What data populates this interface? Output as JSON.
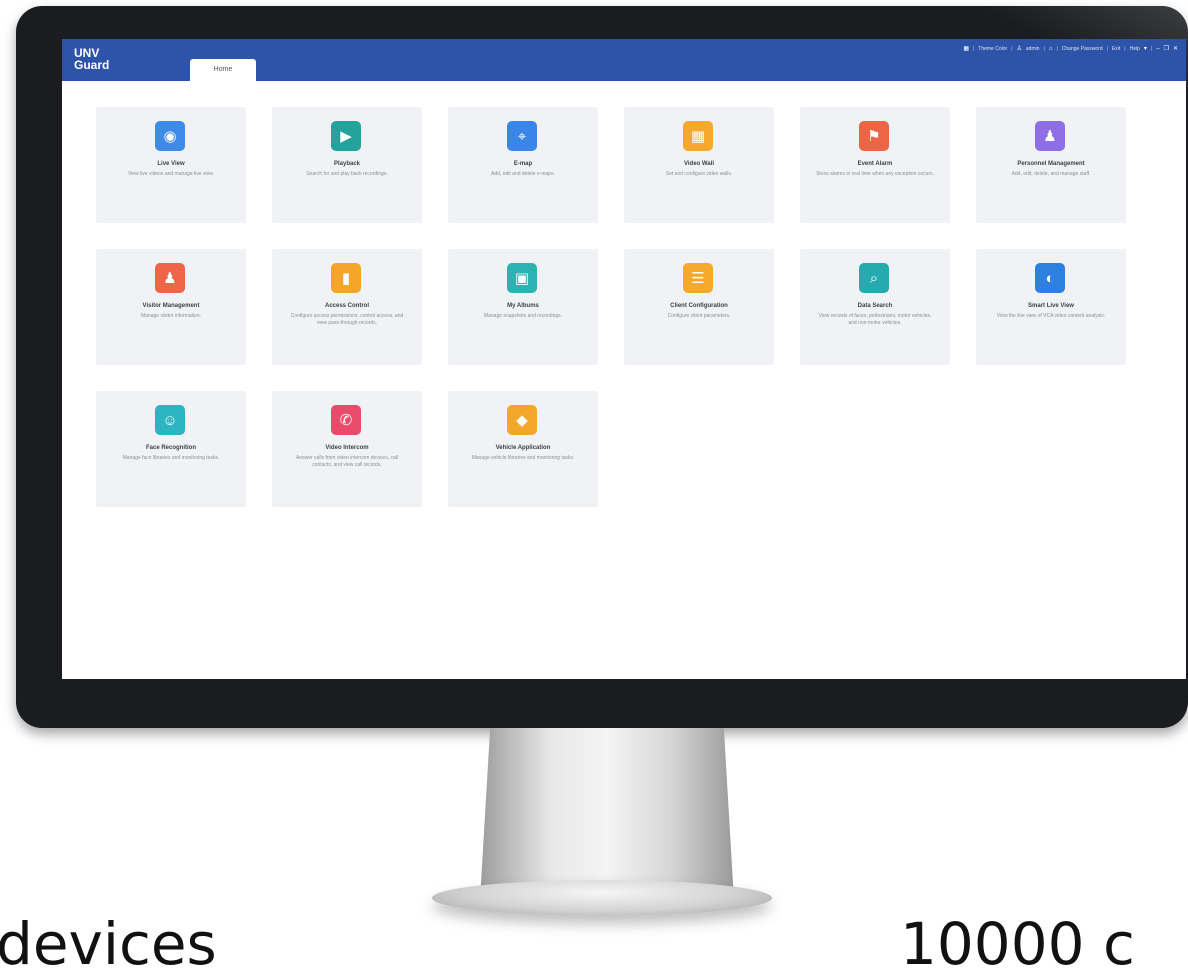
{
  "app": {
    "brand_line1": "UNV",
    "brand_line2": "Guard",
    "tab_home": "Home"
  },
  "toplinks": {
    "menu_icon": "grid-icon",
    "theme_color": "Theme Color",
    "user": "admin",
    "lock_icon": "lock-icon",
    "change_password": "Change Password",
    "exit": "Exit",
    "help": "Help"
  },
  "modules": [
    {
      "title": "Live View",
      "desc": "View live videos and manage live view.",
      "icon": "camera-icon",
      "color": "#3d8ae9",
      "glyph": "◉"
    },
    {
      "title": "Playback",
      "desc": "Search for and play back recordings.",
      "icon": "playback-icon",
      "color": "#23a39b",
      "glyph": "▶"
    },
    {
      "title": "E-map",
      "desc": "Add, edit and delete e-maps.",
      "icon": "map-icon",
      "color": "#3a86e8",
      "glyph": "⌖"
    },
    {
      "title": "Video Wall",
      "desc": "Set and configure video walls.",
      "icon": "grid-wall-icon",
      "color": "#f4a92e",
      "glyph": "▦"
    },
    {
      "title": "Event Alarm",
      "desc": "Show alarms in real time when any exception occurs.",
      "icon": "alarm-icon",
      "color": "#ec6545",
      "glyph": "⚑"
    },
    {
      "title": "Personnel Management",
      "desc": "Add, edit, delete, and manage staff.",
      "icon": "personnel-icon",
      "color": "#8e6fe5",
      "glyph": "♟"
    },
    {
      "title": "Visitor Management",
      "desc": "Manage visitor information.",
      "icon": "visitor-icon",
      "color": "#ee6547",
      "glyph": "♟"
    },
    {
      "title": "Access Control",
      "desc": "Configure access permissions, control access, and view pass-through records.",
      "icon": "door-icon",
      "color": "#f5a52a",
      "glyph": "▮"
    },
    {
      "title": "My Albums",
      "desc": "Manage snapshots and recordings.",
      "icon": "album-icon",
      "color": "#2ab3b0",
      "glyph": "▣"
    },
    {
      "title": "Client Configuration",
      "desc": "Configure client parameters.",
      "icon": "config-icon",
      "color": "#f6aa2c",
      "glyph": "☰"
    },
    {
      "title": "Data Search",
      "desc": "View records of faces, pedestrians, motor vehicles, and non-motor vehicles.",
      "icon": "search-icon",
      "color": "#25aab0",
      "glyph": "⌕"
    },
    {
      "title": "Smart Live View",
      "desc": "View the live view of VCA video content analysis.",
      "icon": "smart-view-icon",
      "color": "#2d7fe0",
      "glyph": "◐"
    },
    {
      "title": "Face Recognition",
      "desc": "Manage face libraries and monitoring tasks.",
      "icon": "face-icon",
      "color": "#2bb5c0",
      "glyph": "☺"
    },
    {
      "title": "Video Intercom",
      "desc": "Answer calls from video intercom devices, call contacts, and view call records.",
      "icon": "phone-icon",
      "color": "#ea4b6a",
      "glyph": "✆"
    },
    {
      "title": "Vehicle Application",
      "desc": "Manage vehicle libraries and monitoring tasks.",
      "icon": "vehicle-icon",
      "color": "#f3a72b",
      "glyph": "◆"
    }
  ],
  "caption": {
    "left": "devices",
    "right": "10000 c"
  }
}
